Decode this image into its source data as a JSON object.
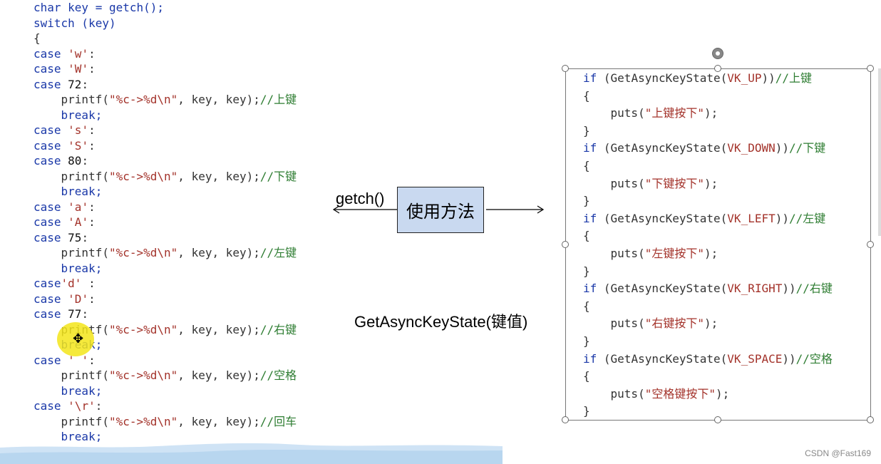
{
  "left_code": [
    [
      {
        "t": "char key = getch();",
        "c": "kw"
      }
    ],
    [
      {
        "t": "switch (key)",
        "c": "kw"
      }
    ],
    [
      {
        "t": "{",
        "c": "punct"
      }
    ],
    [
      {
        "t": "case ",
        "c": "kw"
      },
      {
        "t": "'w'",
        "c": "str"
      },
      {
        "t": ":",
        "c": "punct"
      }
    ],
    [
      {
        "t": "case ",
        "c": "kw"
      },
      {
        "t": "'W'",
        "c": "str"
      },
      {
        "t": ":",
        "c": "punct"
      }
    ],
    [
      {
        "t": "case ",
        "c": "kw"
      },
      {
        "t": "72",
        "c": "num"
      },
      {
        "t": ":",
        "c": "punct"
      }
    ],
    [
      {
        "t": "    printf(",
        "c": "punct"
      },
      {
        "t": "\"%c->%d\\n\"",
        "c": "str"
      },
      {
        "t": ", key, key);",
        "c": "punct"
      },
      {
        "t": "//上键",
        "c": "cmt"
      }
    ],
    [
      {
        "t": "    break;",
        "c": "kw"
      }
    ],
    [
      {
        "t": "case ",
        "c": "kw"
      },
      {
        "t": "'s'",
        "c": "str"
      },
      {
        "t": ":",
        "c": "punct"
      }
    ],
    [
      {
        "t": "case ",
        "c": "kw"
      },
      {
        "t": "'S'",
        "c": "str"
      },
      {
        "t": ":",
        "c": "punct"
      }
    ],
    [
      {
        "t": "case ",
        "c": "kw"
      },
      {
        "t": "80",
        "c": "num"
      },
      {
        "t": ":",
        "c": "punct"
      }
    ],
    [
      {
        "t": "    printf(",
        "c": "punct"
      },
      {
        "t": "\"%c->%d\\n\"",
        "c": "str"
      },
      {
        "t": ", key, key);",
        "c": "punct"
      },
      {
        "t": "//下键",
        "c": "cmt"
      }
    ],
    [
      {
        "t": "    break;",
        "c": "kw"
      }
    ],
    [
      {
        "t": "case ",
        "c": "kw"
      },
      {
        "t": "'a'",
        "c": "str"
      },
      {
        "t": ":",
        "c": "punct"
      }
    ],
    [
      {
        "t": "case ",
        "c": "kw"
      },
      {
        "t": "'A'",
        "c": "str"
      },
      {
        "t": ":",
        "c": "punct"
      }
    ],
    [
      {
        "t": "case ",
        "c": "kw"
      },
      {
        "t": "75",
        "c": "num"
      },
      {
        "t": ":",
        "c": "punct"
      }
    ],
    [
      {
        "t": "    printf(",
        "c": "punct"
      },
      {
        "t": "\"%c->%d\\n\"",
        "c": "str"
      },
      {
        "t": ", key, key);",
        "c": "punct"
      },
      {
        "t": "//左键",
        "c": "cmt"
      }
    ],
    [
      {
        "t": "    break;",
        "c": "kw"
      }
    ],
    [
      {
        "t": "case",
        "c": "kw"
      },
      {
        "t": "'d'",
        "c": "str"
      },
      {
        "t": " :",
        "c": "punct"
      }
    ],
    [
      {
        "t": "case ",
        "c": "kw"
      },
      {
        "t": "'D'",
        "c": "str"
      },
      {
        "t": ":",
        "c": "punct"
      }
    ],
    [
      {
        "t": "case ",
        "c": "kw"
      },
      {
        "t": "77",
        "c": "num"
      },
      {
        "t": ":",
        "c": "punct"
      }
    ],
    [
      {
        "t": "    printf(",
        "c": "punct"
      },
      {
        "t": "\"%c->%d\\n\"",
        "c": "str"
      },
      {
        "t": ", key, key);",
        "c": "punct"
      },
      {
        "t": "//右键",
        "c": "cmt"
      }
    ],
    [
      {
        "t": "    break;",
        "c": "kw"
      }
    ],
    [
      {
        "t": "case ",
        "c": "kw"
      },
      {
        "t": "' '",
        "c": "str"
      },
      {
        "t": ":",
        "c": "punct"
      }
    ],
    [
      {
        "t": "    printf(",
        "c": "punct"
      },
      {
        "t": "\"%c->%d\\n\"",
        "c": "str"
      },
      {
        "t": ", key, key);",
        "c": "punct"
      },
      {
        "t": "//空格",
        "c": "cmt"
      }
    ],
    [
      {
        "t": "    break;",
        "c": "kw"
      }
    ],
    [
      {
        "t": "case ",
        "c": "kw"
      },
      {
        "t": "'\\r'",
        "c": "str"
      },
      {
        "t": ":",
        "c": "punct"
      }
    ],
    [
      {
        "t": "    printf(",
        "c": "punct"
      },
      {
        "t": "\"%c->%d\\n\"",
        "c": "str"
      },
      {
        "t": ", key, key);",
        "c": "punct"
      },
      {
        "t": "//回车",
        "c": "cmt"
      }
    ],
    [
      {
        "t": "    break;",
        "c": "kw"
      }
    ],
    [
      {
        "t": "}",
        "c": "punct"
      }
    ]
  ],
  "center": {
    "box_label": "使用方法",
    "getch_label": "getch()",
    "gaks_label": "GetAsyncKeyState(键值)",
    "box_color": "#c9d9f0"
  },
  "right_code": [
    [
      {
        "t": "if ",
        "c": "kw"
      },
      {
        "t": "(GetAsyncKeyState(",
        "c": "punct"
      },
      {
        "t": "VK_UP",
        "c": "str"
      },
      {
        "t": "))",
        "c": "punct"
      },
      {
        "t": "//上键",
        "c": "cmt"
      }
    ],
    [
      {
        "t": "{",
        "c": "punct"
      }
    ],
    [
      {
        "t": "    puts(",
        "c": "punct"
      },
      {
        "t": "\"上键按下\"",
        "c": "str"
      },
      {
        "t": ");",
        "c": "punct"
      }
    ],
    [
      {
        "t": "}",
        "c": "punct"
      }
    ],
    [
      {
        "t": "if ",
        "c": "kw"
      },
      {
        "t": "(GetAsyncKeyState(",
        "c": "punct"
      },
      {
        "t": "VK_DOWN",
        "c": "str"
      },
      {
        "t": "))",
        "c": "punct"
      },
      {
        "t": "//下键",
        "c": "cmt"
      }
    ],
    [
      {
        "t": "{",
        "c": "punct"
      }
    ],
    [
      {
        "t": "    puts(",
        "c": "punct"
      },
      {
        "t": "\"下键按下\"",
        "c": "str"
      },
      {
        "t": ");",
        "c": "punct"
      }
    ],
    [
      {
        "t": "}",
        "c": "punct"
      }
    ],
    [
      {
        "t": "if ",
        "c": "kw"
      },
      {
        "t": "(GetAsyncKeyState(",
        "c": "punct"
      },
      {
        "t": "VK_LEFT",
        "c": "str"
      },
      {
        "t": "))",
        "c": "punct"
      },
      {
        "t": "//左键",
        "c": "cmt"
      }
    ],
    [
      {
        "t": "{",
        "c": "punct"
      }
    ],
    [
      {
        "t": "    puts(",
        "c": "punct"
      },
      {
        "t": "\"左键按下\"",
        "c": "str"
      },
      {
        "t": ");",
        "c": "punct"
      }
    ],
    [
      {
        "t": "}",
        "c": "punct"
      }
    ],
    [
      {
        "t": "if ",
        "c": "kw"
      },
      {
        "t": "(GetAsyncKeyState(",
        "c": "punct"
      },
      {
        "t": "VK_RIGHT",
        "c": "str"
      },
      {
        "t": "))",
        "c": "punct"
      },
      {
        "t": "//右键",
        "c": "cmt"
      }
    ],
    [
      {
        "t": "{",
        "c": "punct"
      }
    ],
    [
      {
        "t": "    puts(",
        "c": "punct"
      },
      {
        "t": "\"右键按下\"",
        "c": "str"
      },
      {
        "t": ");",
        "c": "punct"
      }
    ],
    [
      {
        "t": "}",
        "c": "punct"
      }
    ],
    [
      {
        "t": "if ",
        "c": "kw"
      },
      {
        "t": "(GetAsyncKeyState(",
        "c": "punct"
      },
      {
        "t": "VK_SPACE",
        "c": "str"
      },
      {
        "t": "))",
        "c": "punct"
      },
      {
        "t": "//空格",
        "c": "cmt"
      }
    ],
    [
      {
        "t": "{",
        "c": "punct"
      }
    ],
    [
      {
        "t": "    puts(",
        "c": "punct"
      },
      {
        "t": "\"空格键按下\"",
        "c": "str"
      },
      {
        "t": ");",
        "c": "punct"
      }
    ],
    [
      {
        "t": "}",
        "c": "punct"
      }
    ]
  ],
  "watermark": "CSDN @Fast169",
  "colors": {
    "keyword": "#1a38a8",
    "string": "#a3322a",
    "comment": "#2e7d32",
    "highlight": "#f3e51a"
  }
}
